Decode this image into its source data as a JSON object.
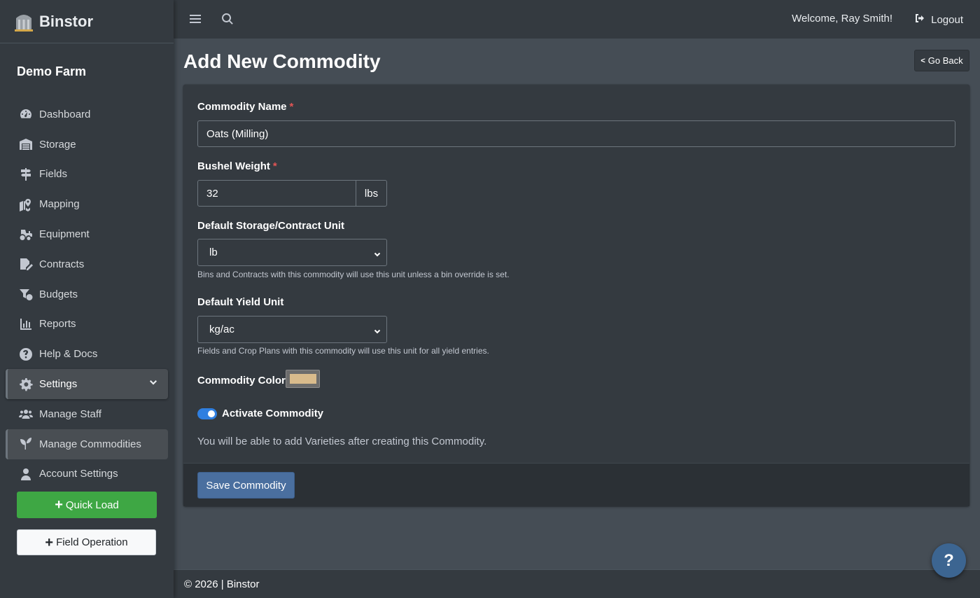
{
  "brand": {
    "name": "Binstor",
    "logo_icon": "silo-icon"
  },
  "farm": {
    "name": "Demo Farm"
  },
  "sidebar": {
    "items": [
      {
        "label": "Dashboard",
        "icon": "gauge-icon"
      },
      {
        "label": "Storage",
        "icon": "warehouse-icon"
      },
      {
        "label": "Fields",
        "icon": "signpost-icon"
      },
      {
        "label": "Mapping",
        "icon": "map-icon"
      },
      {
        "label": "Equipment",
        "icon": "tractor-icon"
      },
      {
        "label": "Contracts",
        "icon": "contract-icon"
      },
      {
        "label": "Budgets",
        "icon": "budget-icon"
      },
      {
        "label": "Reports",
        "icon": "chart-icon"
      },
      {
        "label": "Help & Docs",
        "icon": "question-icon"
      },
      {
        "label": "Settings",
        "icon": "gear-icon",
        "expanded": true
      },
      {
        "label": "Manage Staff",
        "icon": "users-icon"
      },
      {
        "label": "Manage Commodities",
        "icon": "seedling-icon",
        "active": true
      },
      {
        "label": "Account Settings",
        "icon": "user-icon"
      }
    ],
    "quick_load": "Quick Load",
    "field_operation": "Field Operation"
  },
  "topbar": {
    "welcome": "Welcome, Ray Smith!",
    "logout": "Logout"
  },
  "page": {
    "title": "Add New Commodity",
    "go_back": "Go Back"
  },
  "form": {
    "commodity_name_label": "Commodity Name",
    "commodity_name_value": "Oats (Milling)",
    "required_mark": "*",
    "bushel_weight_label": "Bushel Weight",
    "bushel_weight_value": "32",
    "bushel_weight_unit": "lbs",
    "storage_unit_label": "Default Storage/Contract Unit",
    "storage_unit_value": "lb",
    "storage_unit_help": "Bins and Contracts with this commodity will use this unit unless a bin override is set.",
    "yield_unit_label": "Default Yield Unit",
    "yield_unit_value": "kg/ac",
    "yield_unit_help": "Fields and Crop Plans with this commodity will use this unit for all yield entries.",
    "color_label": "Commodity Color",
    "color_value": "#d9bb8c",
    "activate_label": "Activate Commodity",
    "activate_on": true,
    "note": "You will be able to add Varieties after creating this Commodity.",
    "save_label": "Save Commodity"
  },
  "footer": {
    "text": "© 2026 | Binstor"
  },
  "help_fab": {
    "label": "?"
  },
  "colors": {
    "accent": "#4a6f9f",
    "success": "#3ea744",
    "toggle": "#2f7fe0",
    "required": "#e25555"
  }
}
